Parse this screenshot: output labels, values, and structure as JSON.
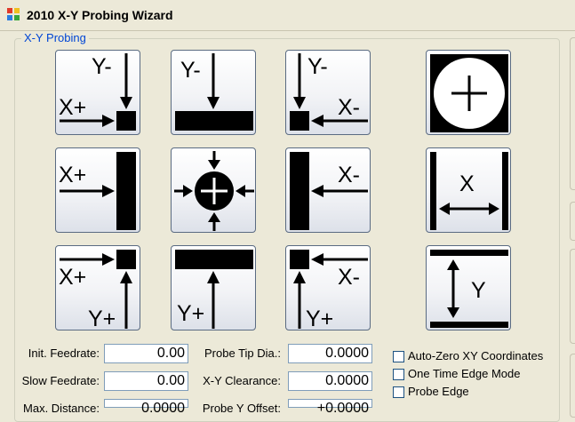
{
  "window": {
    "title": "2010 X-Y Probing Wizard"
  },
  "group": {
    "label": "X-Y Probing"
  },
  "glyphs": {
    "x_plus": "X+",
    "x_minus": "X-",
    "y_plus": "Y+",
    "y_minus": "Y-",
    "x": "X",
    "y": "Y"
  },
  "fields": {
    "init_feedrate": {
      "label": "Init. Feedrate:",
      "value": "0.00"
    },
    "slow_feedrate": {
      "label": "Slow Feedrate:",
      "value": "0.00"
    },
    "max_distance": {
      "label": "Max. Distance:",
      "value": "0.0000"
    },
    "probe_tip_dia": {
      "label": "Probe Tip Dia.:",
      "value": "0.0000"
    },
    "xy_clearance": {
      "label": "X-Y Clearance:",
      "value": "0.0000"
    },
    "probe_y_offset": {
      "label": "Probe Y Offset:",
      "value": "+0.0000"
    }
  },
  "checkboxes": [
    {
      "label": "Auto-Zero XY Coordinates",
      "checked": false
    },
    {
      "label": "One Time Edge Mode",
      "checked": false
    },
    {
      "label": "Probe Edge",
      "checked": false
    }
  ]
}
